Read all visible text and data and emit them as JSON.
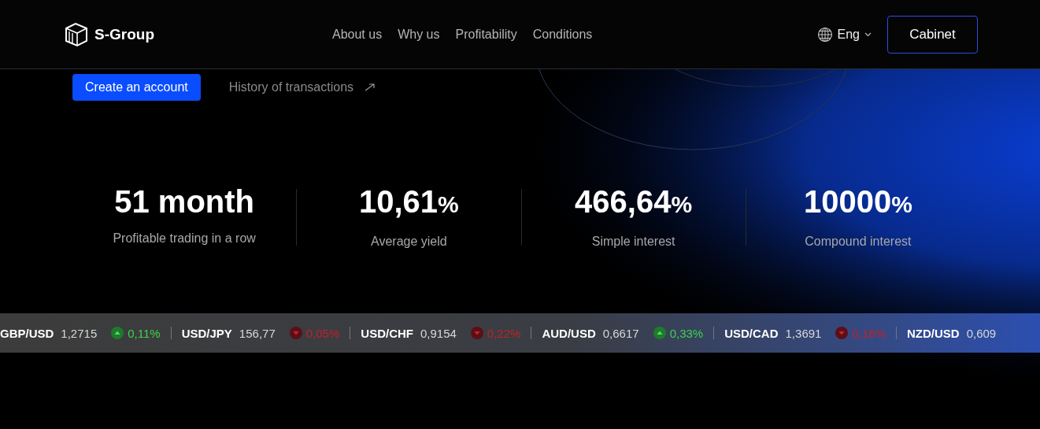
{
  "header": {
    "brand": "S-Group",
    "nav": [
      {
        "label": "About us"
      },
      {
        "label": "Why us"
      },
      {
        "label": "Profitability"
      },
      {
        "label": "Conditions"
      }
    ],
    "language": "Eng",
    "cabinet": "Cabinet"
  },
  "hero": {
    "primary_button": "Create an account",
    "history_link": "History of transactions"
  },
  "stats": [
    {
      "value": "51 month",
      "label": "Profitable trading in a row"
    },
    {
      "value": "10,61",
      "unit": "%",
      "label": "Average yield"
    },
    {
      "value": "466,64",
      "unit": "%",
      "label": "Simple interest"
    },
    {
      "value": "10000",
      "unit": "%",
      "label": "Compound interest"
    }
  ],
  "ticker": [
    {
      "pair": "GBP/USD",
      "price": "1,2715",
      "change": "0,11%",
      "kind": "up"
    },
    {
      "pair": "USD/JPY",
      "price": "156,77",
      "change": "0,05%",
      "kind": "down"
    },
    {
      "pair": "USD/CHF",
      "price": "0,9154",
      "change": "0,22%",
      "kind": "down"
    },
    {
      "pair": "AUD/USD",
      "price": "0,6617",
      "change": "0,33%",
      "kind": "up"
    },
    {
      "pair": "USD/CAD",
      "price": "1,3691",
      "change": "0,16%",
      "kind": "down"
    },
    {
      "pair": "NZD/USD",
      "price": "0,609"
    }
  ]
}
